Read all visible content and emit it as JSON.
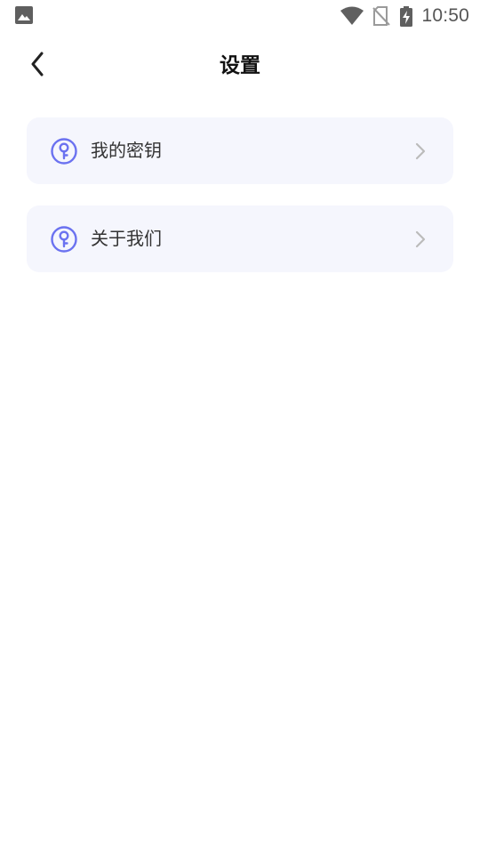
{
  "status_bar": {
    "time": "10:50",
    "icons": [
      "image-icon",
      "wifi-icon",
      "no-sim-icon",
      "battery-charging-icon"
    ]
  },
  "header": {
    "title": "设置",
    "back_icon": "chevron-left-icon"
  },
  "settings": {
    "items": [
      {
        "label": "我的密钥",
        "icon": "key-circle-icon"
      },
      {
        "label": "关于我们",
        "icon": "key-circle-icon"
      }
    ]
  },
  "colors": {
    "accent": "#6b72f0",
    "card_background": "#f5f6fd",
    "chevron": "#bbbbbb",
    "text": "#333333"
  }
}
